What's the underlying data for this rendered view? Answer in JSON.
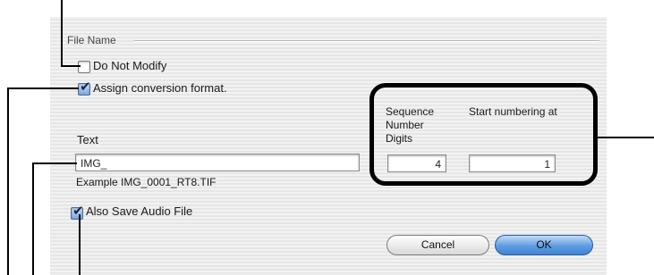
{
  "file_name": {
    "legend": "File Name",
    "do_not_modify": {
      "label": "Do Not Modify",
      "checked": false
    },
    "assign_conversion": {
      "label": "Assign conversion format.",
      "checked": true
    },
    "text_label": "Text",
    "text_value": "IMG_",
    "example": "Example IMG_0001_RT8.TIF",
    "also_save_audio": {
      "label": "Also Save Audio File",
      "checked": true
    }
  },
  "sequence": {
    "digits_label_1": "Sequence",
    "digits_label_2": "Number",
    "digits_label_3": "Digits",
    "digits_value": "4",
    "start_label": "Start numbering at",
    "start_value": "1"
  },
  "buttons": {
    "cancel": "Cancel",
    "ok": "OK"
  },
  "colors": {
    "ok_button": "#5f9ce2",
    "checkbox_checked": "#7ea7dc",
    "callout": "#000000"
  }
}
